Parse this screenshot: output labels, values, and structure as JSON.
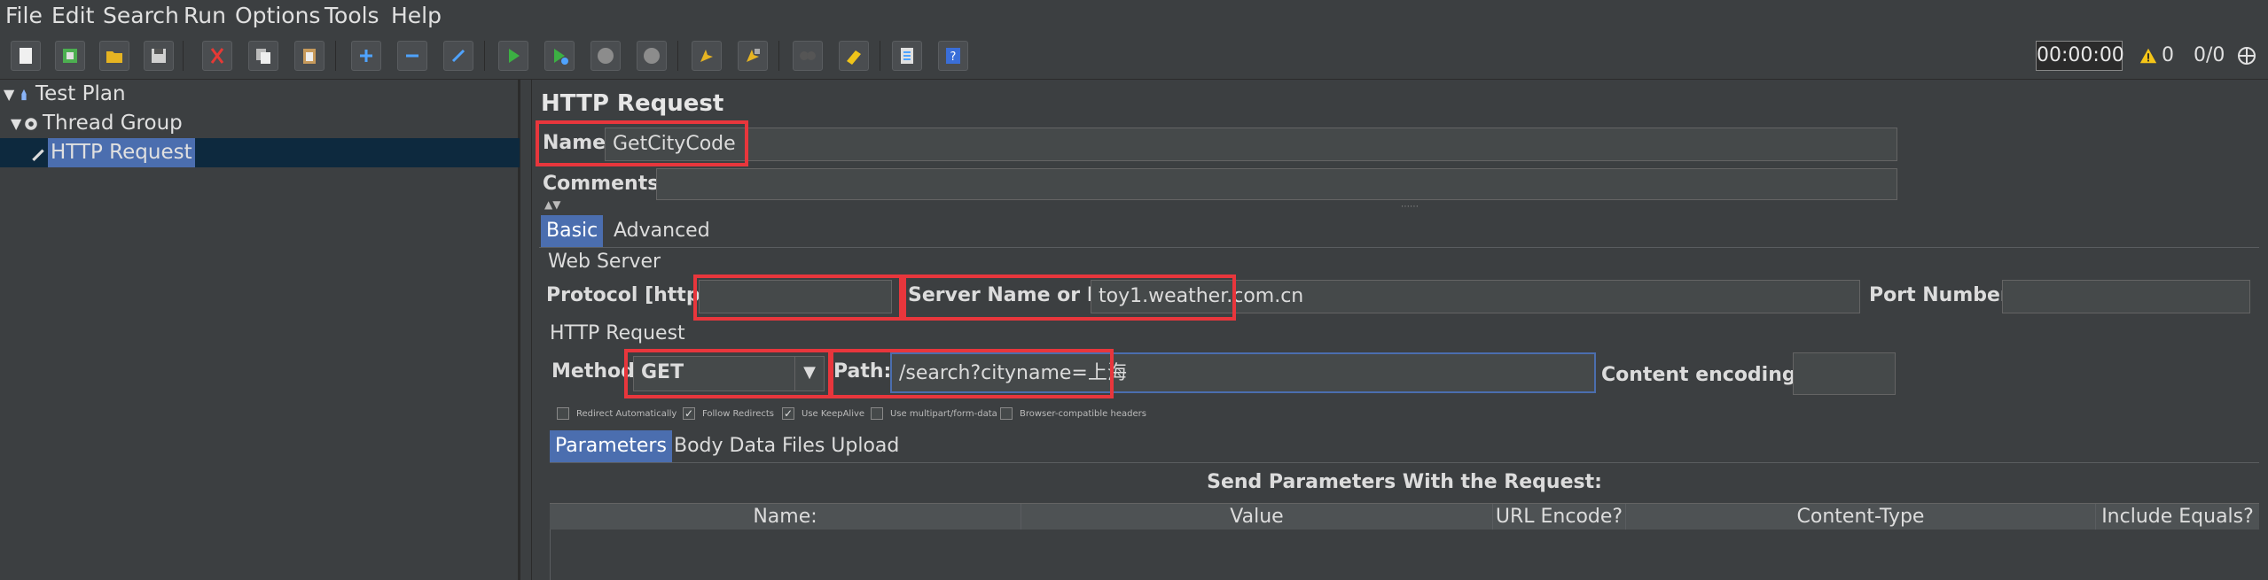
{
  "menubar": {
    "items": [
      {
        "label": "File"
      },
      {
        "label": "Edit"
      },
      {
        "label": "Search"
      },
      {
        "label": "Run"
      },
      {
        "label": "Options"
      },
      {
        "label": "Tools"
      },
      {
        "label": "Help"
      }
    ]
  },
  "toolbar": {
    "timer": "00:00:00",
    "warning_count": "0",
    "thread_count": "0/0",
    "icons": [
      "new-icon",
      "templates-icon",
      "open-icon",
      "save-icon",
      "cut-icon",
      "copy-icon",
      "paste-icon",
      "expand-icon",
      "collapse-icon",
      "toggle-icon",
      "start-icon",
      "start-no-pauses-icon",
      "stop-icon",
      "shutdown-icon",
      "clear-icon",
      "clear-all-icon",
      "search-icon",
      "reset-search-icon",
      "function-helper-icon",
      "help-icon",
      "globe-icon"
    ]
  },
  "tree": {
    "items": [
      {
        "label": "Test Plan",
        "icon": "test-plan-icon"
      },
      {
        "label": "Thread Group",
        "icon": "gear-icon"
      },
      {
        "label": "HTTP Request",
        "icon": "pipette-icon"
      }
    ]
  },
  "panel": {
    "title": "HTTP Request",
    "name_label": "Name:",
    "name_value": "GetCityCode",
    "comments_label": "Comments:",
    "tabs": [
      {
        "label": "Basic"
      },
      {
        "label": "Advanced"
      }
    ],
    "web_server": {
      "title": "Web Server",
      "protocol_label": "Protocol [http]:",
      "protocol_value": "",
      "server_label": "Server Name or IP:",
      "server_value": "toy1.weather.com.cn",
      "port_label": "Port Number:",
      "port_value": ""
    },
    "http_request": {
      "title": "HTTP Request",
      "method_label": "Method:",
      "method_value": "GET",
      "path_label": "Path:",
      "path_value": "/search?cityname=上海",
      "encoding_label": "Content encoding:",
      "encoding_value": ""
    },
    "checkboxes": [
      {
        "label": "Redirect Automatically",
        "checked": false
      },
      {
        "label": "Follow Redirects",
        "checked": true
      },
      {
        "label": "Use KeepAlive",
        "checked": true
      },
      {
        "label": "Use multipart/form-data",
        "checked": false
      },
      {
        "label": "Browser-compatible headers",
        "checked": false
      }
    ],
    "param_tabs": [
      {
        "label": "Parameters"
      },
      {
        "label": "Body Data"
      },
      {
        "label": "Files Upload"
      }
    ],
    "params_caption": "Send Parameters With the Request:",
    "columns": [
      "Name:",
      "Value",
      "URL Encode?",
      "Content-Type",
      "Include Equals?"
    ]
  }
}
